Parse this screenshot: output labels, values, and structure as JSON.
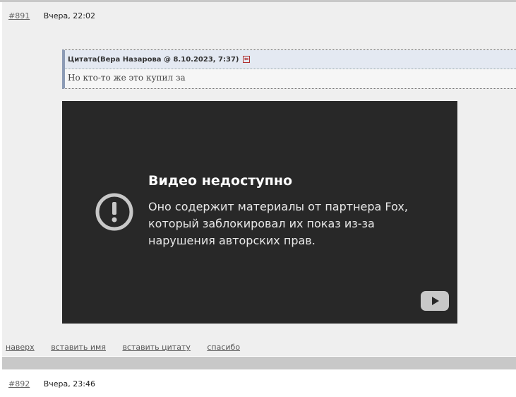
{
  "post1": {
    "number": "#891",
    "time": "Вчера, 22:02",
    "quote": {
      "header": "Цитата(Вера Назарова @ 8.10.2023, 7:37)",
      "text": "Но кто-то же это купил за"
    },
    "video": {
      "title": "Видео недоступно",
      "message": "Оно содержит материалы от партнера Fox, который заблокировал их показ из-за нарушения авторских прав.",
      "icons": [
        "alert-circle-icon",
        "youtube-logo-icon"
      ]
    },
    "links": [
      "наверх",
      "вставить имя",
      "вставить цитату",
      "спасибо"
    ]
  },
  "post2": {
    "number": "#892",
    "time": "Вчера, 23:46"
  },
  "colors": {
    "post_bg": "#efefef",
    "separator": "#c8c8c8",
    "video_bg": "#282828",
    "quote_header_bg": "#e4e9f2",
    "link": "#555555"
  }
}
